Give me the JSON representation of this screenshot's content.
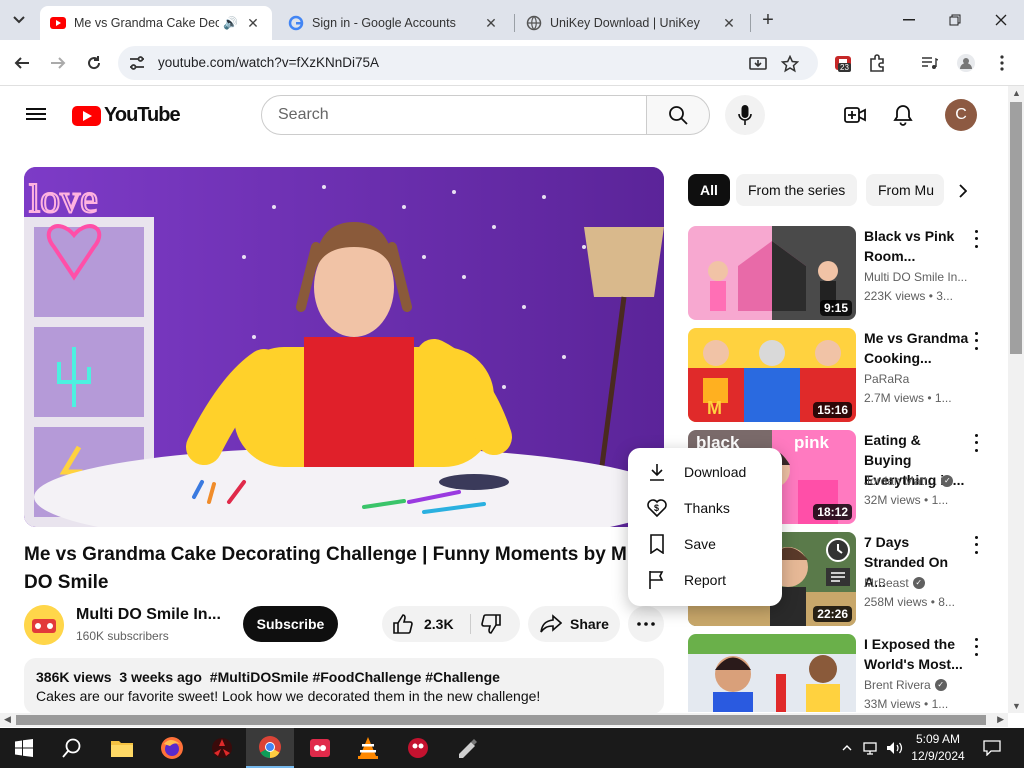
{
  "browser": {
    "tabs": [
      {
        "title": "Me vs Grandma Cake Decorating Challenge",
        "icon": "youtube-favicon",
        "active": true
      },
      {
        "title": "Sign in - Google Accounts",
        "icon": "google-favicon",
        "active": false
      },
      {
        "title": "UniKey Download | UniKey",
        "icon": "globe-favicon",
        "active": false
      }
    ],
    "url": "youtube.com/watch?v=fXzKNnDi75A",
    "extension_badge": "23"
  },
  "youtube": {
    "logo_text": "YouTube",
    "search_placeholder": "Search",
    "avatar_letter": "C"
  },
  "video": {
    "title": "Me vs Grandma Cake Decorating Challenge | Funny Moments by Multi DO Smile",
    "channel": "Multi DO Smile In...",
    "subscribers": "160K subscribers",
    "subscribe_label": "Subscribe",
    "likes": "2.3K",
    "share_label": "Share",
    "more_label": "...",
    "views": "386K views",
    "age": "3 weeks ago",
    "hashtags": "#MultiDOSmile #FoodChallenge #Challenge",
    "description": "Cakes are our favorite sweet! Look how we decorated them in the new challenge!"
  },
  "chips": [
    "All",
    "From the series",
    "From Mu"
  ],
  "recommendations": [
    {
      "title": "Black vs Pink Room...",
      "channel": "Multi DO Smile In...",
      "verified": false,
      "views": "223K views",
      "age": "3...",
      "duration": "9:15"
    },
    {
      "title": "Me vs Grandma Cooking...",
      "channel": "PaRaRa",
      "verified": false,
      "views": "2.7M views",
      "age": "1...",
      "duration": "15:16"
    },
    {
      "title": "Eating & Buying Everything in...",
      "channel": "Jordan Matt...",
      "verified": true,
      "views": "32M views",
      "age": "1...",
      "duration": "18:12",
      "thumb_text_left": "black",
      "thumb_text_right": "pink"
    },
    {
      "title": "7 Days Stranded On A...",
      "channel": "MrBeast",
      "verified": true,
      "views": "258M views",
      "age": "8...",
      "duration": "22:26"
    },
    {
      "title": "I Exposed the World's Most...",
      "channel": "Brent Rivera",
      "verified": true,
      "views": "33M views",
      "age": "1...",
      "duration": ""
    }
  ],
  "popup_menu": {
    "items": [
      {
        "label": "Download",
        "icon": "download-icon"
      },
      {
        "label": "Thanks",
        "icon": "thanks-icon"
      },
      {
        "label": "Save",
        "icon": "bookmark-icon"
      },
      {
        "label": "Report",
        "icon": "flag-icon"
      }
    ]
  },
  "taskbar": {
    "time": "5:09 AM",
    "date": "12/9/2024"
  },
  "colors": {
    "youtube_red": "#ff0000",
    "tab_strip": "#dfe3eb",
    "chip_active": "#0f0f0f",
    "video_bg": "#6a2fb0"
  }
}
